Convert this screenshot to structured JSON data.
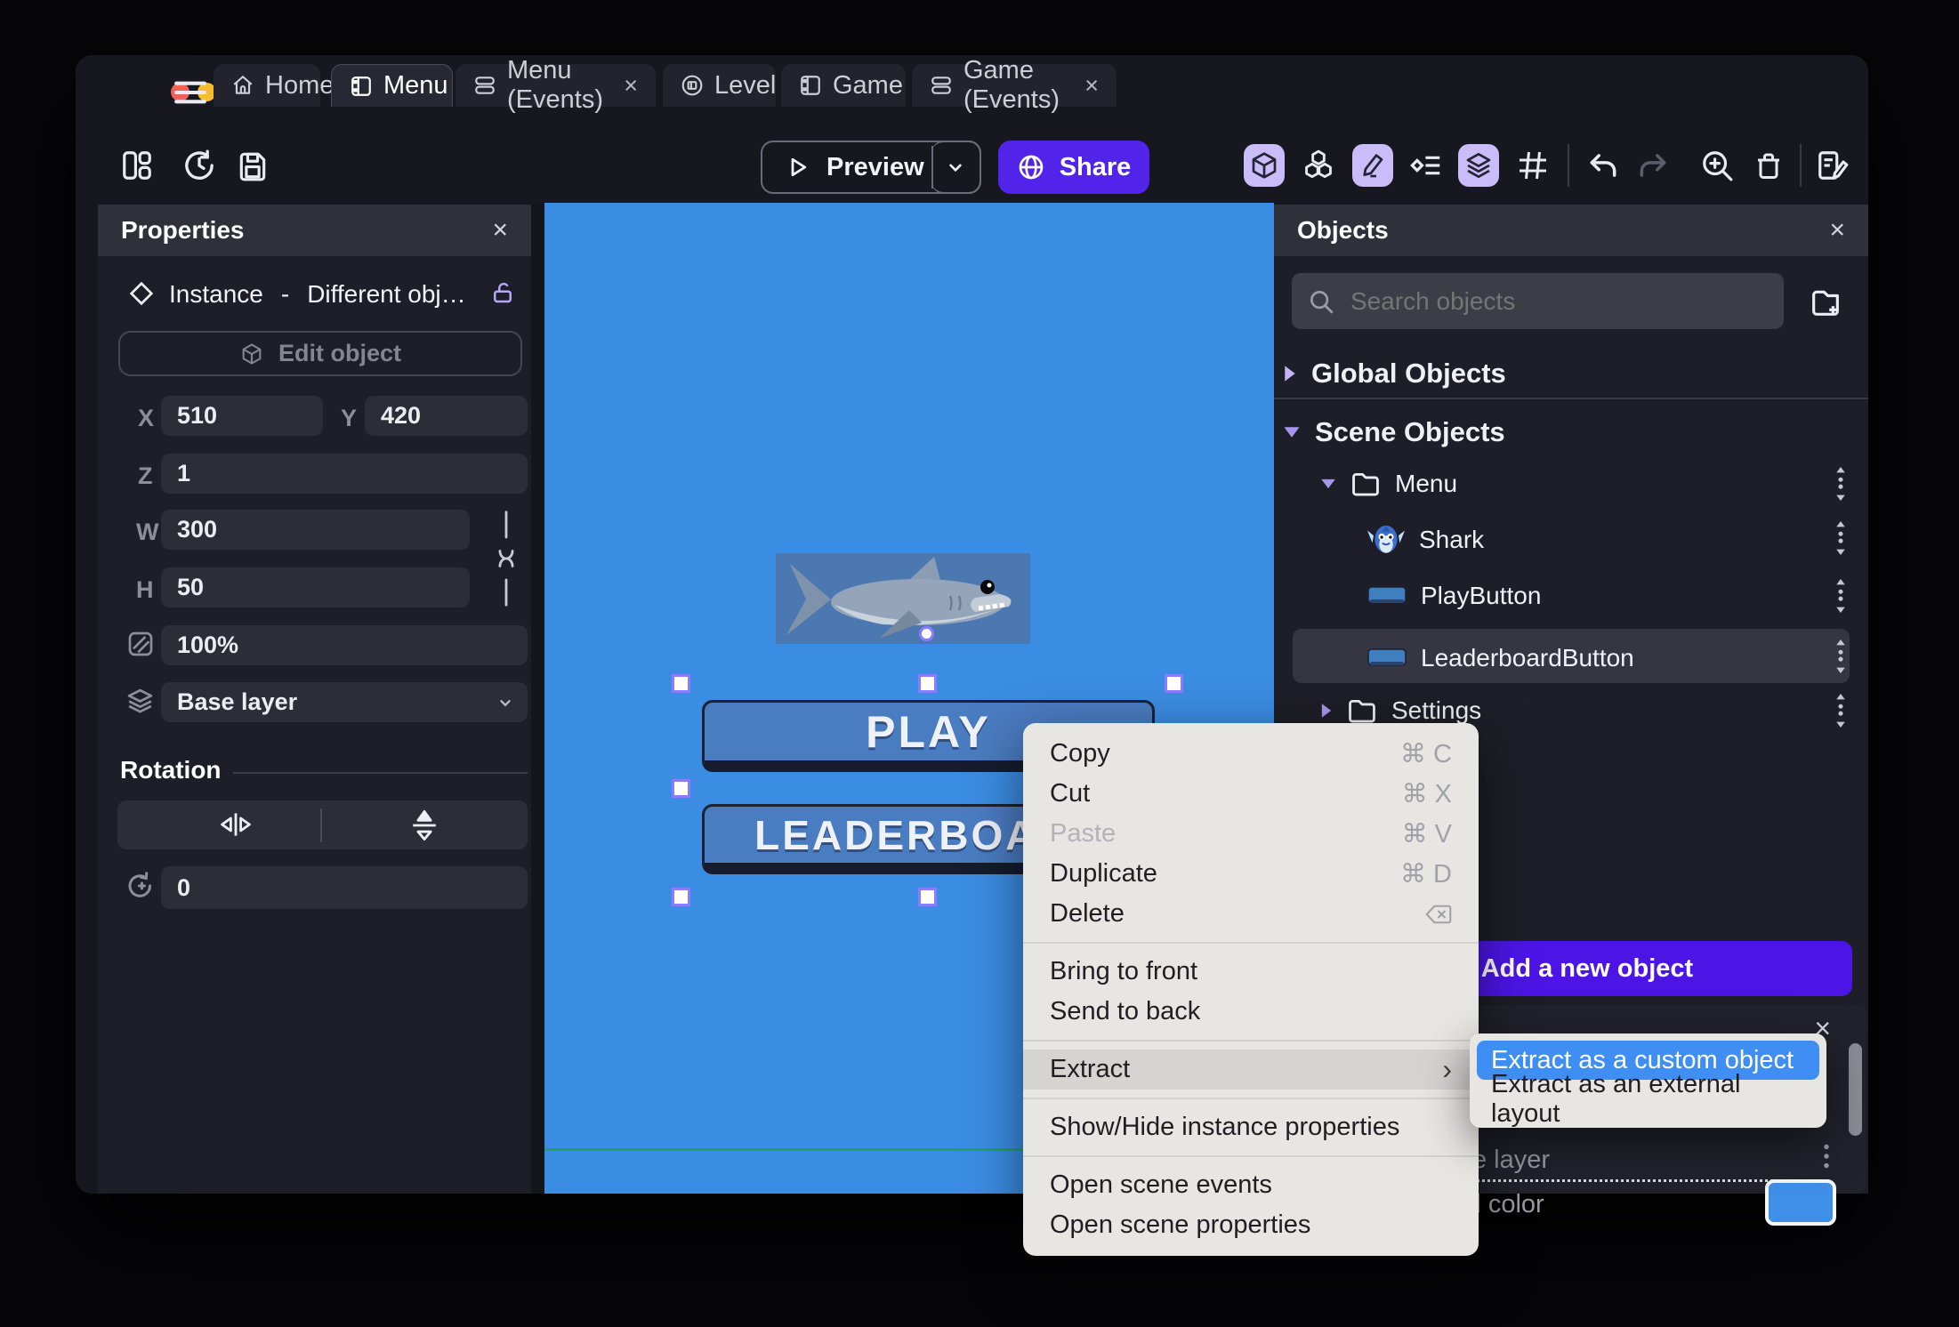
{
  "ui": {
    "close": "×",
    "submenu_arrow": "›",
    "plus": "+",
    "dash": "-"
  },
  "colors": {
    "accent_purple": "#5223e8",
    "add_button_purple": "#4c15e6",
    "selection_blue": "#3f8ef3",
    "canvas_blue": "#3b8de3",
    "scene_line_green": "#27a05f",
    "icon_highlight": "#c9bcf8",
    "swatch_blue": "#3f8fe8",
    "traffic_red": "#f25f58",
    "traffic_yellow": "#f7bd2e",
    "traffic_green": "#30c440"
  },
  "tabs": [
    {
      "label": "Home"
    },
    {
      "label": "Menu"
    },
    {
      "label": "Menu (Events)"
    },
    {
      "label": "Level"
    },
    {
      "label": "Game"
    },
    {
      "label": "Game (Events)"
    }
  ],
  "toolbar": {
    "preview": "Preview",
    "share": "Share"
  },
  "props": {
    "title": "Properties",
    "instance_kind": "Instance",
    "instance_name": "Different obj…",
    "edit_object": "Edit object",
    "x_label": "X",
    "x": "510",
    "y_label": "Y",
    "y": "420",
    "z_label": "Z",
    "z": "1",
    "w_label": "W",
    "w": "300",
    "h_label": "H",
    "h": "50",
    "opacity": "100%",
    "layer": "Base layer",
    "rotation_title": "Rotation",
    "rotation_value": "0"
  },
  "canvas": {
    "play": "PLAY",
    "leaderboard": "LEADERBOARD"
  },
  "objects": {
    "title": "Objects",
    "search_placeholder": "Search objects",
    "global": "Global Objects",
    "scene": "Scene Objects",
    "folder_menu": "Menu",
    "item_shark": "Shark",
    "item_play": "PlayButton",
    "item_leaderboard": "LeaderboardButton",
    "folder_settings": "Settings",
    "add_new": "Add a new object",
    "layer_row": "Base layer",
    "color_row": "Background color"
  },
  "menu": {
    "items": [
      {
        "label": "Copy",
        "shortcut": "⌘ C"
      },
      {
        "label": "Cut",
        "shortcut": "⌘ X"
      },
      {
        "label": "Paste",
        "shortcut": "⌘ V"
      },
      {
        "label": "Duplicate",
        "shortcut": "⌘ D"
      },
      {
        "label": "Delete",
        "shortcut": ""
      },
      {
        "label": "Bring to front",
        "shortcut": ""
      },
      {
        "label": "Send to back",
        "shortcut": ""
      },
      {
        "label": "Extract",
        "shortcut": ""
      },
      {
        "label": "Show/Hide instance properties",
        "shortcut": ""
      },
      {
        "label": "Open scene events",
        "shortcut": ""
      },
      {
        "label": "Open scene properties",
        "shortcut": ""
      }
    ]
  },
  "submenu": {
    "custom": "Extract as a custom object",
    "external": "Extract as an external layout"
  }
}
